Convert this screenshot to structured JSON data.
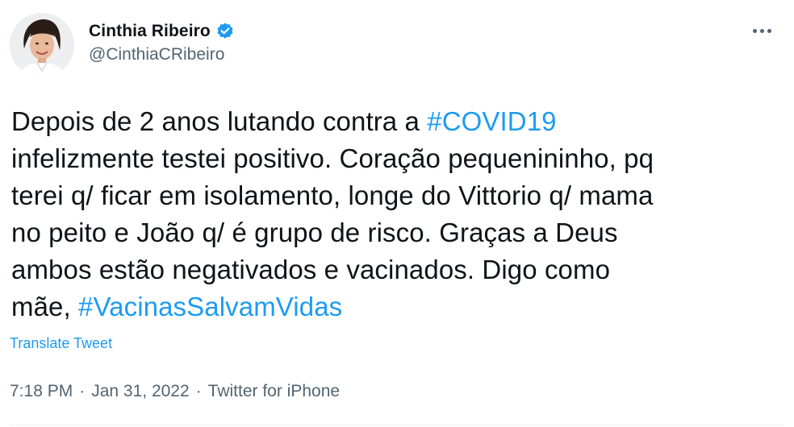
{
  "author": {
    "display_name": "Cinthia Ribeiro",
    "handle": "@CinthiaCRibeiro",
    "verified_icon": "verified-badge-icon",
    "avatar": "profile-photo"
  },
  "menu": {
    "icon": "more-options-icon"
  },
  "tweet": {
    "line1_a": "Depois de 2 anos lutando contra a ",
    "line1_tag": "#COVID19",
    "line2": "infelizmente testei positivo. Coração pequenininho, pq",
    "line3": "terei q/ ficar em isolamento, longe do Vittorio q/ mama",
    "line4": "no peito e João q/ é grupo de risco. Graças a Deus",
    "line5": "ambos estão negativados e vacinados. Digo como",
    "line6_a": "mãe, ",
    "line6_tag": "#VacinasSalvamVidas"
  },
  "translate_label": "Translate Tweet",
  "meta": {
    "time": "7:18 PM",
    "separator": "·",
    "date": "Jan 31, 2022",
    "source": "Twitter for iPhone"
  },
  "colors": {
    "link": "#1d9bf0",
    "secondary_text": "#536471",
    "primary_text": "#0f1419"
  }
}
